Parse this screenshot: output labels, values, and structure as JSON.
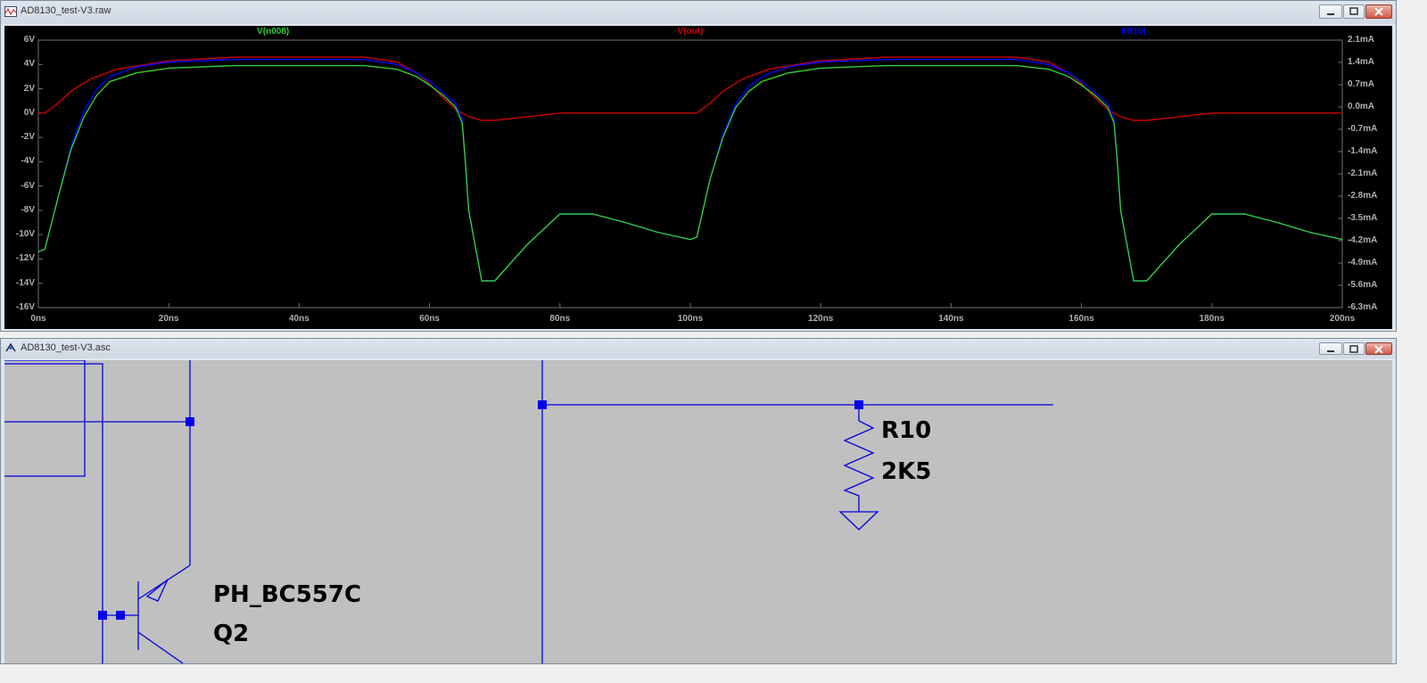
{
  "waveform_window": {
    "title": "AD8130_test-V3.raw",
    "y_left_ticks": [
      "6V",
      "4V",
      "2V",
      "0V",
      "-2V",
      "-4V",
      "-6V",
      "-8V",
      "-10V",
      "-12V",
      "-14V",
      "-16V"
    ],
    "y_right_ticks": [
      "2.1mA",
      "1.4mA",
      "0.7mA",
      "0.0mA",
      "-0.7mA",
      "-1.4mA",
      "-2.1mA",
      "-2.8mA",
      "-3.5mA",
      "-4.2mA",
      "-4.9mA",
      "-5.6mA",
      "-6.3mA"
    ],
    "x_ticks": [
      "0ns",
      "20ns",
      "40ns",
      "60ns",
      "80ns",
      "100ns",
      "120ns",
      "140ns",
      "160ns",
      "180ns",
      "200ns"
    ],
    "traces": [
      {
        "label": "V(n008)",
        "color": "#33cc33"
      },
      {
        "label": "V(out)",
        "color": "#cc0000"
      },
      {
        "label": "I(R10)",
        "color": "#0000ff"
      }
    ]
  },
  "chart_data": {
    "type": "line",
    "xlabel": "",
    "ylabel": "",
    "x_unit": "ns",
    "xlim": [
      0,
      200
    ],
    "ylim": [
      -16,
      6
    ],
    "ylim_right": [
      -6.3,
      2.1
    ],
    "grid": false,
    "series": [
      {
        "name": "V(n008)",
        "axis": "left",
        "color": "#33cc33",
        "x": [
          0,
          1,
          3,
          5,
          7,
          9,
          11,
          15,
          20,
          30,
          50,
          55,
          58,
          60,
          62,
          64,
          65,
          65.5,
          66,
          68,
          70,
          75,
          80,
          85,
          90,
          95,
          100,
          101,
          103,
          105,
          107,
          109,
          111,
          115,
          120,
          130,
          150,
          155,
          158,
          160,
          162,
          164,
          165,
          165.5,
          166,
          168,
          170,
          175,
          180,
          185,
          190,
          195,
          200
        ],
        "y": [
          -11.4,
          -11.2,
          -7,
          -3,
          -0.3,
          1.5,
          2.6,
          3.3,
          3.7,
          3.9,
          3.9,
          3.6,
          3.0,
          2.3,
          1.5,
          0.5,
          -0.8,
          -4,
          -8,
          -13.8,
          -13.8,
          -10.8,
          -8.3,
          -8.3,
          -9.0,
          -9.8,
          -10.4,
          -10.2,
          -5.5,
          -2.0,
          0.5,
          1.8,
          2.6,
          3.3,
          3.7,
          3.9,
          3.9,
          3.6,
          3.0,
          2.3,
          1.5,
          0.5,
          -0.8,
          -4,
          -8,
          -13.8,
          -13.8,
          -10.8,
          -8.3,
          -8.3,
          -9.0,
          -9.8,
          -10.4
        ]
      },
      {
        "name": "V(out)",
        "axis": "left",
        "color": "#cc0000",
        "x": [
          0,
          1,
          3,
          5,
          8,
          12,
          20,
          30,
          50,
          55,
          58,
          60,
          62,
          64,
          66,
          68,
          70,
          75,
          80,
          100,
          101,
          103,
          105,
          108,
          112,
          120,
          130,
          150,
          155,
          158,
          160,
          162,
          164,
          166,
          168,
          170,
          175,
          180,
          200
        ],
        "y": [
          0,
          0,
          0.8,
          1.8,
          2.8,
          3.6,
          4.3,
          4.6,
          4.6,
          4.2,
          3.3,
          2.4,
          1.3,
          0.3,
          -0.3,
          -0.6,
          -0.6,
          -0.3,
          0,
          0,
          0,
          0.8,
          1.8,
          2.8,
          3.6,
          4.3,
          4.6,
          4.6,
          4.2,
          3.3,
          2.4,
          1.3,
          0.3,
          -0.3,
          -0.6,
          -0.6,
          -0.3,
          0,
          0
        ]
      },
      {
        "name": "I(R10)",
        "axis": "left",
        "color": "#0000ff",
        "x": [
          0,
          1,
          3,
          5,
          7,
          9,
          11,
          15,
          20,
          30,
          50,
          55,
          58,
          60,
          62,
          64,
          65,
          65.5,
          66,
          68,
          70,
          75,
          80,
          85,
          90,
          95,
          100,
          101,
          103,
          105,
          107,
          109,
          111,
          115,
          120,
          130,
          150,
          155,
          158,
          160,
          162,
          164,
          165,
          165.5,
          166,
          168,
          170,
          175,
          180,
          185,
          190,
          195,
          200
        ],
        "y": [
          -11.4,
          -11.2,
          -7,
          -2.8,
          0.2,
          2.0,
          3.0,
          3.8,
          4.2,
          4.4,
          4.4,
          4.0,
          3.3,
          2.6,
          1.7,
          0.8,
          -0.5,
          -4,
          -8,
          -13.8,
          -13.8,
          -10.8,
          -8.3,
          -8.3,
          -9.0,
          -9.8,
          -10.4,
          -10.2,
          -5.5,
          -1.8,
          0.8,
          2.2,
          3.0,
          3.8,
          4.2,
          4.4,
          4.4,
          4.0,
          3.3,
          2.6,
          1.7,
          0.8,
          -0.5,
          -4,
          -8,
          -13.8,
          -13.8,
          -10.8,
          -8.3,
          -8.3,
          -9.0,
          -9.8,
          -10.4
        ]
      }
    ]
  },
  "schematic_window": {
    "title": "AD8130_test-V3.asc",
    "components": [
      {
        "name": "R10",
        "value": "2K5"
      },
      {
        "name": "Q2",
        "value": "PH_BC557C"
      }
    ]
  }
}
